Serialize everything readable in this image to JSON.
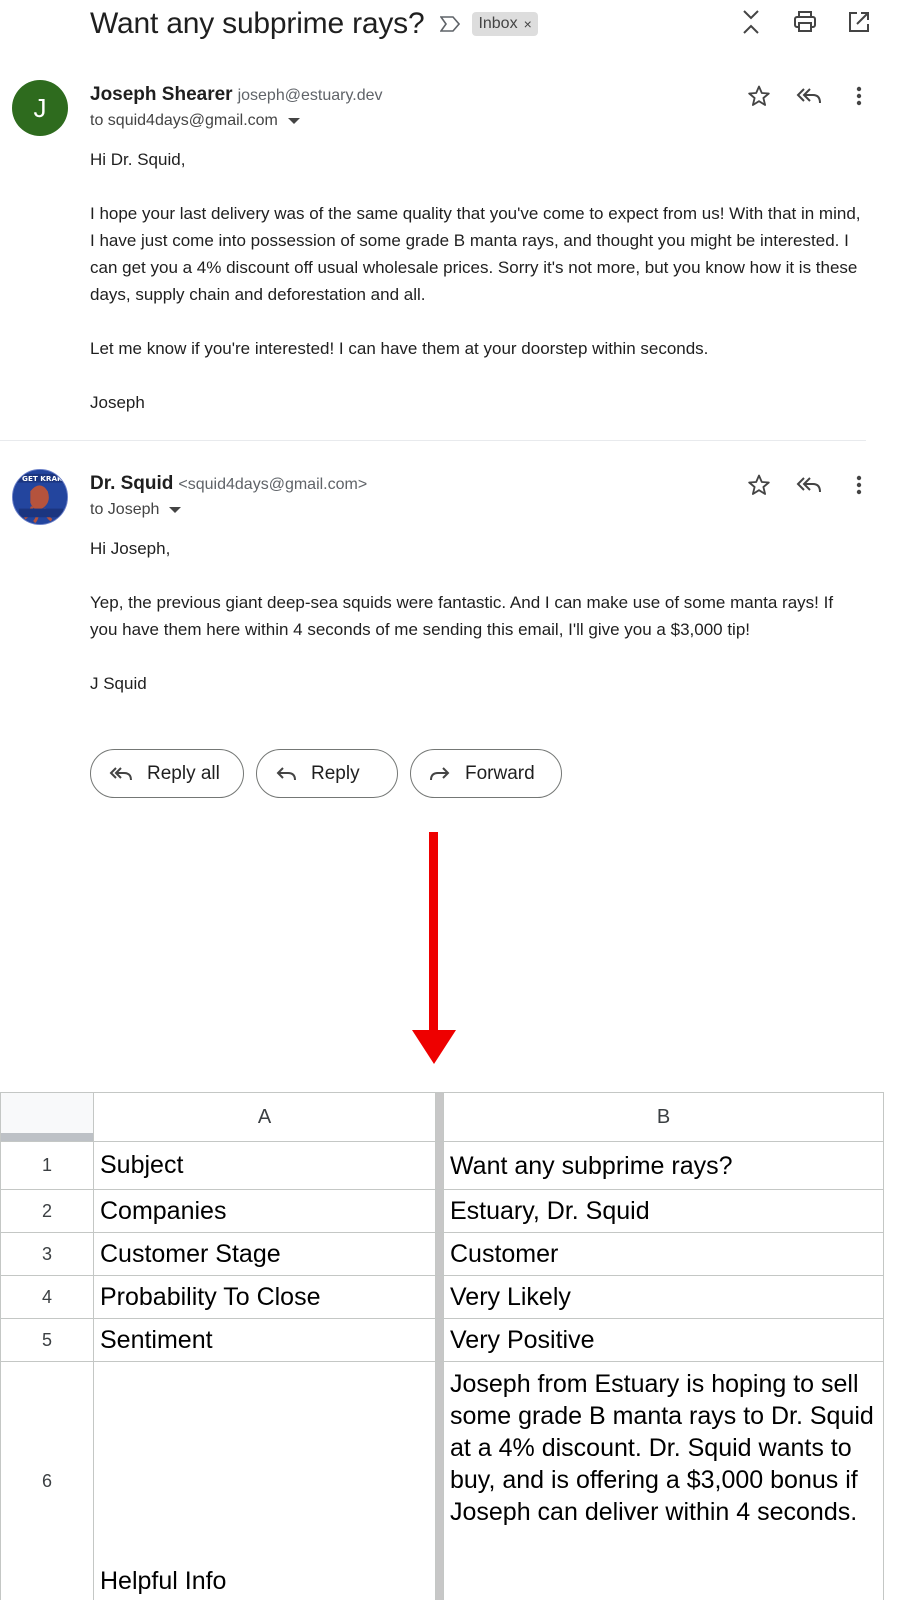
{
  "email": {
    "subject": "Want any subprime rays?",
    "label": "Inbox",
    "label_close": "×"
  },
  "messages": [
    {
      "avatar_letter": "J",
      "avatar_color": "#2e6b1e",
      "sender_name": "Joseph Shearer",
      "sender_email": "joseph@estuary.dev",
      "recipient": "to squid4days@gmail.com",
      "body": [
        "Hi Dr. Squid,",
        "I hope your last delivery was of the same quality that you've come to expect from us! With that in mind, I have just come into possession of some grade B manta rays, and thought you might be interested. I can get you a 4% discount off usual wholesale prices. Sorry it's not more, but you know how it is these days, supply chain and deforestation and all.",
        "Let me know if you're interested! I can have them at your doorstep within seconds.",
        "Joseph"
      ]
    },
    {
      "avatar_text": "LET'S GET KRAKENIN",
      "sender_name": "Dr. Squid",
      "sender_email": "<squid4days@gmail.com>",
      "recipient": "to Joseph",
      "body": [
        "Hi Joseph,",
        "Yep, the previous giant deep-sea squids were fantastic. And I can make use of some manta rays! If you have them here within 4 seconds of me sending this email, I'll give you a $3,000 tip!",
        "J Squid"
      ]
    }
  ],
  "buttons": {
    "reply_all": "Reply all",
    "reply": "Reply",
    "forward": "Forward"
  },
  "arrow_color": "#ee0000",
  "sheet": {
    "columns": [
      "A",
      "B"
    ],
    "rows": [
      {
        "num": "1",
        "a": "Subject",
        "b": "Want any subprime rays?"
      },
      {
        "num": "2",
        "a": "Companies",
        "b": "Estuary, Dr. Squid"
      },
      {
        "num": "3",
        "a": "Customer Stage",
        "b": "Customer"
      },
      {
        "num": "4",
        "a": "Probability To Close",
        "b": "Very Likely"
      },
      {
        "num": "5",
        "a": "Sentiment",
        "b": "Very Positive"
      },
      {
        "num": "6",
        "a": "Helpful Info",
        "b": "Joseph from Estuary is hoping to sell some grade B manta rays to Dr. Squid at a 4% discount. Dr. Squid wants to buy, and is offering a $3,000 bonus if Joseph can deliver within 4 seconds."
      }
    ]
  }
}
